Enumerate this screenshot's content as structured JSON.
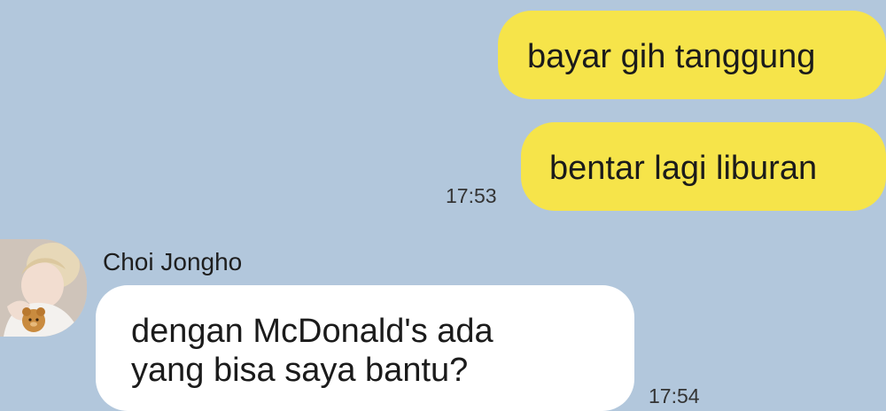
{
  "chat": {
    "messages": [
      {
        "direction": "outgoing",
        "text": "bayar gih tanggung"
      },
      {
        "direction": "outgoing",
        "text": "bentar lagi liburan"
      },
      {
        "direction": "incoming",
        "lines": [
          "dengan McDonald's ada",
          "yang bisa saya bantu?"
        ]
      }
    ],
    "outgoing_time": "17:53",
    "incoming_time": "17:54",
    "contact": {
      "name": "Choi Jongho",
      "avatar_icon": "profile-photo-avatar"
    }
  },
  "colors": {
    "background": "#b2c7dc",
    "outgoing_bubble": "#f6e44a",
    "incoming_bubble": "#ffffff",
    "text": "#1b1b1b"
  }
}
